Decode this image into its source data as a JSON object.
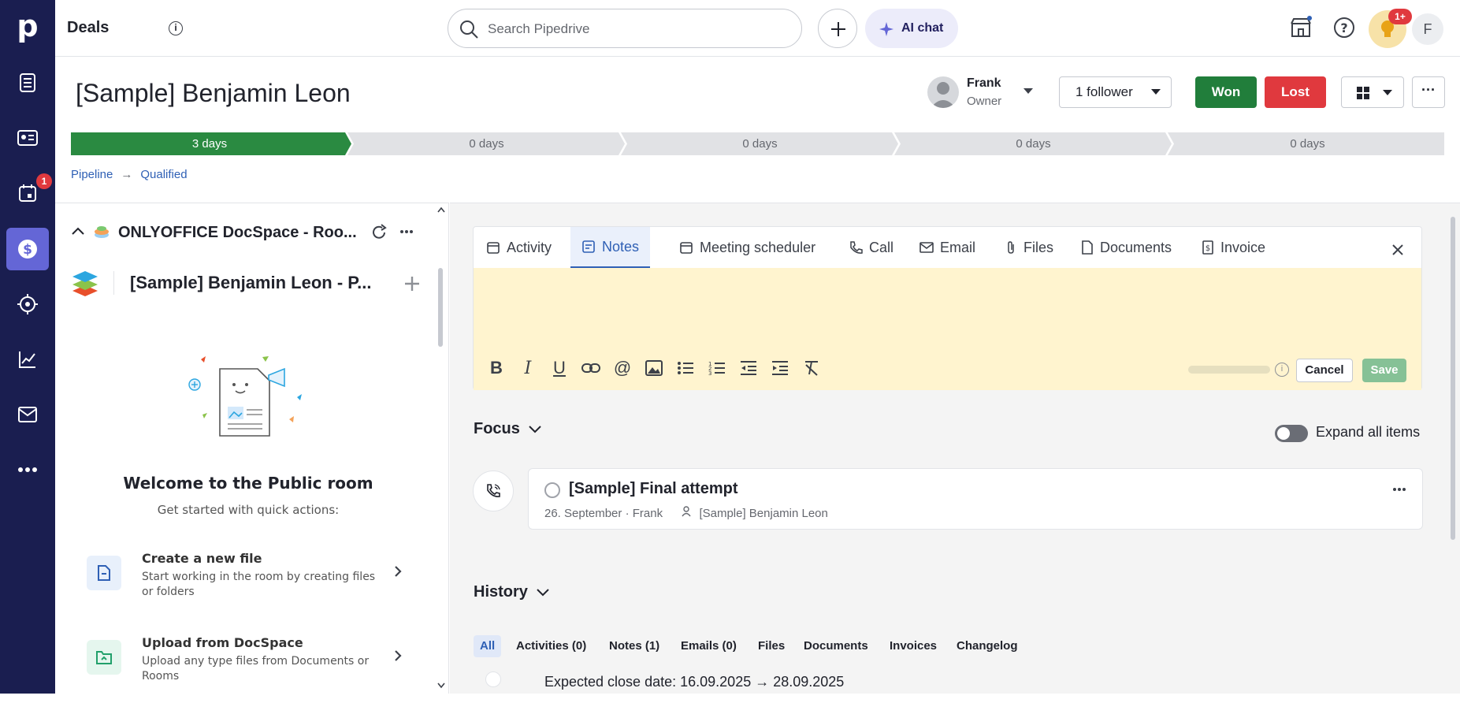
{
  "app": {
    "section_title": "Deals"
  },
  "search": {
    "placeholder": "Search Pipedrive"
  },
  "header": {
    "ai_chat_label": "AI chat",
    "tips_badge": "1+",
    "user_initial": "F"
  },
  "sidebar": {
    "calendar_badge": "1"
  },
  "deal": {
    "title": "[Sample] Benjamin Leon",
    "owner_name": "Frank",
    "owner_role": "Owner",
    "followers_label": "1 follower",
    "won_label": "Won",
    "lost_label": "Lost",
    "more_label": "···"
  },
  "stages": [
    {
      "label": "3 days",
      "active": true
    },
    {
      "label": "0 days",
      "active": false
    },
    {
      "label": "0 days",
      "active": false
    },
    {
      "label": "0 days",
      "active": false
    },
    {
      "label": "0 days",
      "active": false
    }
  ],
  "breadcrumb": {
    "pipeline": "Pipeline",
    "stage": "Qualified"
  },
  "docspace": {
    "panel_title": "ONLYOFFICE DocSpace - Roo...",
    "room_title": "[Sample] Benjamin Leon - P...",
    "welcome_title": "Welcome to the Public room",
    "welcome_subtitle": "Get started with quick actions:",
    "actions": [
      {
        "title": "Create a new file",
        "desc": "Start working in the room by creating files or folders"
      },
      {
        "title": "Upload from DocSpace",
        "desc": "Upload any type files from Documents or Rooms"
      }
    ]
  },
  "editor": {
    "tabs": [
      "Activity",
      "Notes",
      "Meeting scheduler",
      "Call",
      "Email",
      "Files",
      "Documents",
      "Invoice"
    ],
    "active_tab": "Notes",
    "cancel_label": "Cancel",
    "save_label": "Save"
  },
  "focus": {
    "heading": "Focus",
    "expand_label": "Expand all items",
    "activity": {
      "title": "[Sample] Final attempt",
      "date": "26. September",
      "owner": "Frank",
      "person": "[Sample] Benjamin Leon"
    }
  },
  "history": {
    "heading": "History",
    "tabs": [
      "All",
      "Activities (0)",
      "Notes (1)",
      "Emails (0)",
      "Files",
      "Documents",
      "Invoices",
      "Changelog"
    ],
    "active_tab": "All",
    "item_label": "Expected close date",
    "item_value": "16.09.2025 → 28.09.2025"
  },
  "colors": {
    "sidebar": "#1a1e50",
    "won": "#217e3b",
    "lost": "#e0393e",
    "stage_active": "#2a8a41",
    "stage_inactive": "#e1e2e5",
    "note_bg": "#fff4cf",
    "link": "#2f60b5"
  }
}
